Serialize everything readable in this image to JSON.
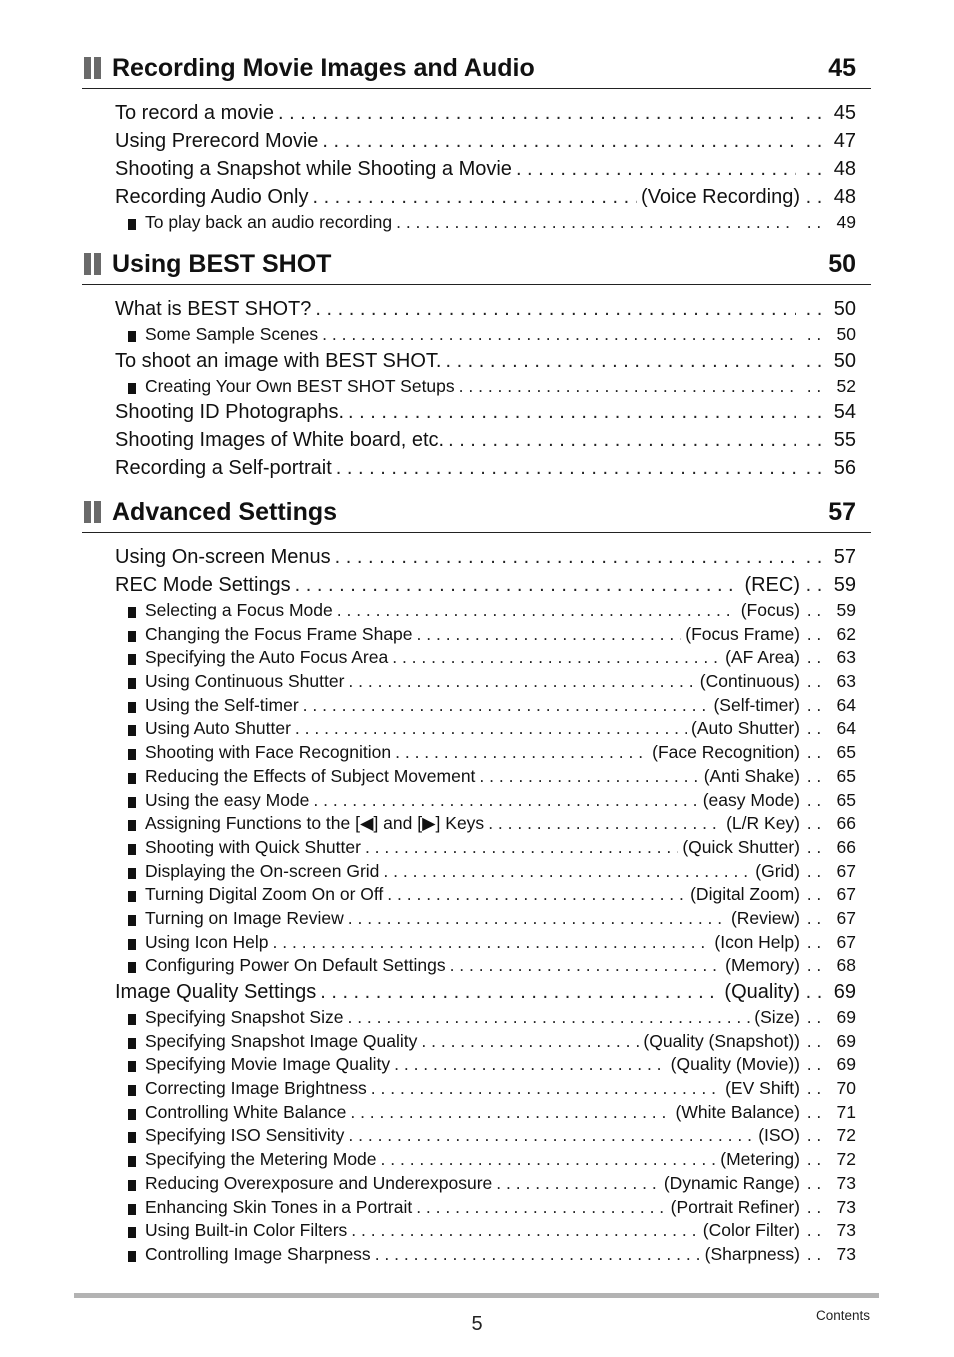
{
  "sections": [
    {
      "title": "Recording Movie Images and Audio",
      "page": "45",
      "entries": [
        {
          "level": 1,
          "text": "To record a movie",
          "tag": "",
          "page": "45"
        },
        {
          "level": 1,
          "text": "Using Prerecord Movie",
          "tag": "",
          "page": "47"
        },
        {
          "level": 1,
          "text": "Shooting a Snapshot while Shooting a Movie",
          "tag": "",
          "page": "48"
        },
        {
          "level": 1,
          "text": "Recording Audio Only",
          "tag": "(Voice Recording)",
          "page": "48"
        },
        {
          "level": 2,
          "text": "To play back an audio recording",
          "tag": "",
          "page": "49"
        }
      ]
    },
    {
      "title": "Using BEST SHOT",
      "page": "50",
      "entries": [
        {
          "level": 1,
          "text": "What is BEST SHOT?",
          "tag": "",
          "page": "50"
        },
        {
          "level": 2,
          "text": "Some Sample Scenes",
          "tag": "",
          "page": "50"
        },
        {
          "level": 1,
          "text": "To shoot an image with BEST SHOT.",
          "tag": "",
          "page": "50"
        },
        {
          "level": 2,
          "text": "Creating Your Own BEST SHOT Setups",
          "tag": "",
          "page": "52"
        },
        {
          "level": 1,
          "text": "Shooting ID Photographs.",
          "tag": "",
          "page": "54"
        },
        {
          "level": 1,
          "text": "Shooting Images of White board, etc.",
          "tag": "",
          "page": "55"
        },
        {
          "level": 1,
          "text": "Recording a Self-portrait",
          "tag": "",
          "page": "56"
        }
      ]
    },
    {
      "title": "Advanced Settings",
      "page": "57",
      "entries": [
        {
          "level": 1,
          "text": "Using On-screen Menus",
          "tag": "",
          "page": "57"
        },
        {
          "level": 1,
          "text": "REC Mode Settings",
          "tag": "(REC)",
          "page": "59"
        },
        {
          "level": 2,
          "text": "Selecting a Focus Mode",
          "tag": "(Focus)",
          "page": "59"
        },
        {
          "level": 2,
          "text": "Changing the Focus Frame Shape",
          "tag": "(Focus Frame)",
          "page": "62"
        },
        {
          "level": 2,
          "text": "Specifying the Auto Focus Area",
          "tag": "(AF Area)",
          "page": "63"
        },
        {
          "level": 2,
          "text": "Using Continuous Shutter",
          "tag": "(Continuous)",
          "page": "63"
        },
        {
          "level": 2,
          "text": "Using the Self-timer",
          "tag": "(Self-timer)",
          "page": "64"
        },
        {
          "level": 2,
          "text": "Using Auto Shutter",
          "tag": "(Auto Shutter)",
          "page": "64"
        },
        {
          "level": 2,
          "text": "Shooting with Face Recognition",
          "tag": "(Face Recognition)",
          "page": "65"
        },
        {
          "level": 2,
          "text": "Reducing the Effects of Subject Movement",
          "tag": "(Anti Shake)",
          "page": "65"
        },
        {
          "level": 2,
          "text": "Using the easy Mode",
          "tag": "(easy Mode)",
          "page": "65"
        },
        {
          "level": 2,
          "text": "Assigning Functions to the [◀] and [▶] Keys",
          "tag": "(L/R Key)",
          "page": "66"
        },
        {
          "level": 2,
          "text": "Shooting with Quick Shutter",
          "tag": "(Quick Shutter)",
          "page": "66"
        },
        {
          "level": 2,
          "text": "Displaying the On-screen Grid",
          "tag": "(Grid)",
          "page": "67"
        },
        {
          "level": 2,
          "text": "Turning Digital Zoom On or Off",
          "tag": "(Digital Zoom)",
          "page": "67"
        },
        {
          "level": 2,
          "text": "Turning on Image Review",
          "tag": "(Review)",
          "page": "67"
        },
        {
          "level": 2,
          "text": "Using Icon Help",
          "tag": "(Icon Help)",
          "page": "67"
        },
        {
          "level": 2,
          "text": "Configuring Power On Default Settings",
          "tag": "(Memory)",
          "page": "68"
        },
        {
          "level": 1,
          "text": "Image Quality Settings",
          "tag": "(Quality)",
          "page": "69"
        },
        {
          "level": 2,
          "text": "Specifying Snapshot Size",
          "tag": "(Size)",
          "page": "69"
        },
        {
          "level": 2,
          "text": "Specifying Snapshot Image Quality",
          "tag": "(Quality (Snapshot))",
          "page": "69"
        },
        {
          "level": 2,
          "text": "Specifying Movie Image Quality",
          "tag": "(Quality (Movie))",
          "page": "69"
        },
        {
          "level": 2,
          "text": "Correcting Image Brightness",
          "tag": "(EV Shift)",
          "page": "70"
        },
        {
          "level": 2,
          "text": "Controlling White Balance",
          "tag": "(White Balance)",
          "page": "71"
        },
        {
          "level": 2,
          "text": "Specifying ISO Sensitivity",
          "tag": "(ISO)",
          "page": "72"
        },
        {
          "level": 2,
          "text": "Specifying the Metering Mode",
          "tag": "(Metering)",
          "page": "72"
        },
        {
          "level": 2,
          "text": "Reducing Overexposure and Underexposure",
          "tag": "(Dynamic Range)",
          "page": "73"
        },
        {
          "level": 2,
          "text": "Enhancing Skin Tones in a Portrait",
          "tag": "(Portrait Refiner)",
          "page": "73"
        },
        {
          "level": 2,
          "text": "Using Built-in Color Filters",
          "tag": "(Color Filter)",
          "page": "73"
        },
        {
          "level": 2,
          "text": "Controlling Image Sharpness",
          "tag": "(Sharpness)",
          "page": "73"
        }
      ]
    }
  ],
  "footer": {
    "page_number": "5",
    "label": "Contents"
  },
  "colors": {
    "section_icon": "#6a6a6a",
    "footer_rule": "#b3b3b3",
    "text": "#111111"
  }
}
